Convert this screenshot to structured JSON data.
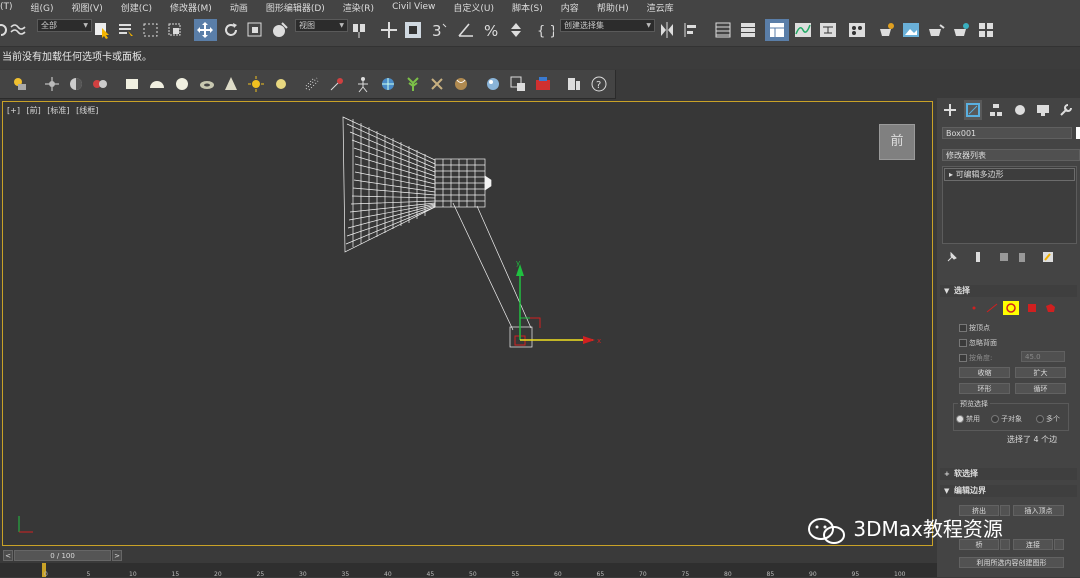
{
  "menu": [
    "组(G)",
    "视图(V)",
    "创建(C)",
    "修改器(M)",
    "动画",
    "图形编辑器(D)",
    "渲染(R)",
    "Civil View",
    "自定义(U)",
    "脚本(S)",
    "内容",
    "帮助(H)",
    "渲云库"
  ],
  "menu_leading": "(T)",
  "toolbar": {
    "filter_dropdown": "全部",
    "refcoord_dropdown": "视图",
    "selection_set_dropdown": "创建选择集"
  },
  "status_text": "当前没有加载任何选项卡或面板。",
  "viewport": {
    "labels": [
      "[+]",
      "[前]",
      "[标准]",
      "[线框]"
    ],
    "viewcube_label": "前",
    "gizmo_x": "x",
    "gizmo_y": "y"
  },
  "panel": {
    "object_name": "Box001",
    "modifier_list": "修改器列表",
    "stack_item": "可编辑多边形",
    "selection": {
      "title": "选择",
      "by_vertex": "按顶点",
      "ignore_backfacing": "忽略背面",
      "by_angle": "按角度:",
      "angle_value": "45.0",
      "shrink": "收缩",
      "grow": "扩大",
      "ring": "环形",
      "loop": "循环",
      "preview_title": "预览选择",
      "preview_options": [
        "禁用",
        "子对象",
        "多个"
      ],
      "status": "选择了 4 个边"
    },
    "soft_selection": "软选择",
    "edit_edges": {
      "title": "编辑边界",
      "extrude": "挤出",
      "insert_vertex": "插入顶点",
      "bridge": "桥",
      "connect": "连接",
      "create_shape": "利用所选内容创建图形"
    }
  },
  "timeline": {
    "frame_display": "0 / 100",
    "ticks": [
      "0",
      "5",
      "10",
      "15",
      "20",
      "25",
      "30",
      "35",
      "40",
      "45",
      "50",
      "55",
      "60",
      "65",
      "70",
      "75",
      "80",
      "85",
      "90",
      "95",
      "100"
    ]
  },
  "watermark": "3DMax教程资源",
  "colors": {
    "viewport_border": "#c9a227",
    "gizmo_x": "#d02020",
    "gizmo_y": "#20c040",
    "highlight": "#ffff00"
  }
}
